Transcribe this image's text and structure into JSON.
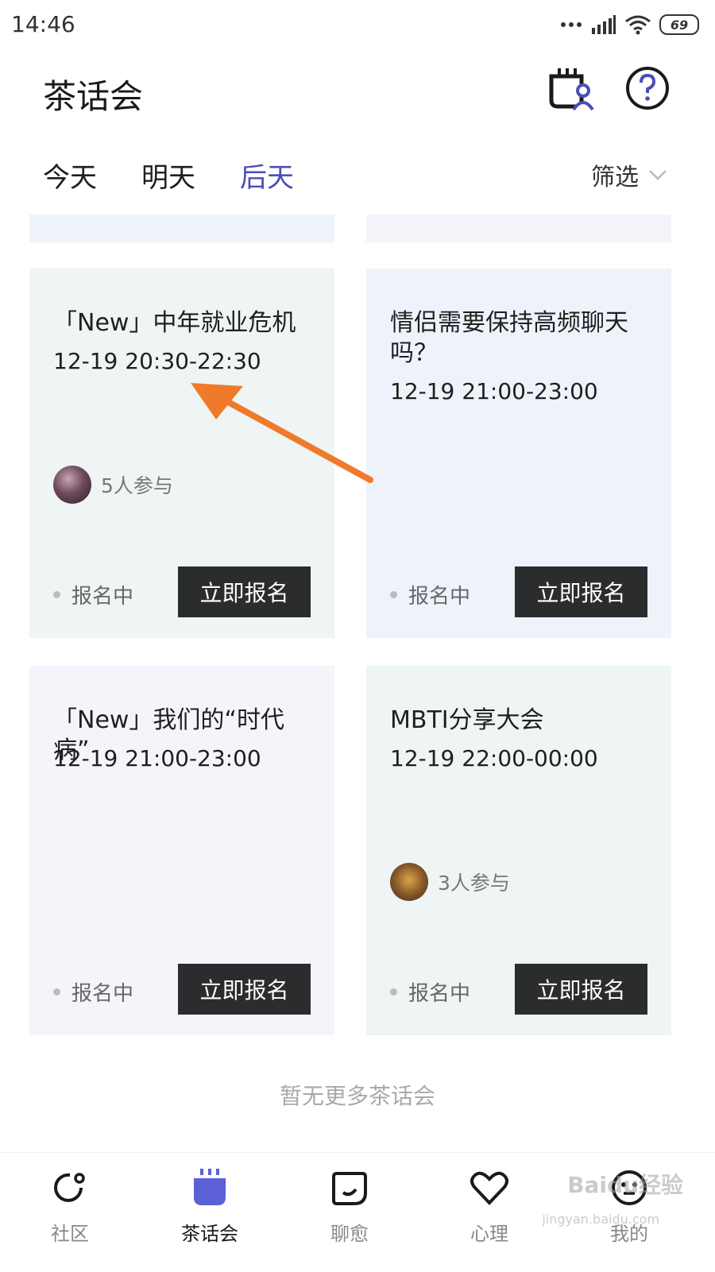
{
  "status_bar": {
    "time": "14:46",
    "battery": "69"
  },
  "header": {
    "title": "茶话会"
  },
  "tabs": [
    {
      "label": "今天"
    },
    {
      "label": "明天"
    },
    {
      "label": "后天",
      "active": true
    }
  ],
  "filter": {
    "label": "筛选"
  },
  "cards": [
    {
      "title": "「New」中年就业危机",
      "time": "12-19 20:30-22:30",
      "participants": "5人参与",
      "status": "报名中",
      "button": "立即报名"
    },
    {
      "title": "情侣需要保持高频聊天吗？",
      "time": "12-19 21:00-23:00",
      "status": "报名中",
      "button": "立即报名"
    },
    {
      "title": "「New」我们的“时代病”",
      "time": "12-19 21:00-23:00",
      "status": "报名中",
      "button": "立即报名"
    },
    {
      "title": "MBTI分享大会",
      "time": "12-19 22:00-00:00",
      "participants": "3人参与",
      "status": "报名中",
      "button": "立即报名"
    }
  ],
  "empty_text": "暂无更多茶话会",
  "bottom_nav": [
    {
      "label": "社区"
    },
    {
      "label": "茶话会",
      "active": true
    },
    {
      "label": "聊愈"
    },
    {
      "label": "心理"
    },
    {
      "label": "我的"
    }
  ],
  "watermark": {
    "text": "Baidu经验",
    "sub": "jingyan.baidu.com"
  },
  "colors": {
    "accent": "#4a4fb5",
    "button_bg": "#2b2c2e",
    "arrow": "#f07a2c"
  }
}
